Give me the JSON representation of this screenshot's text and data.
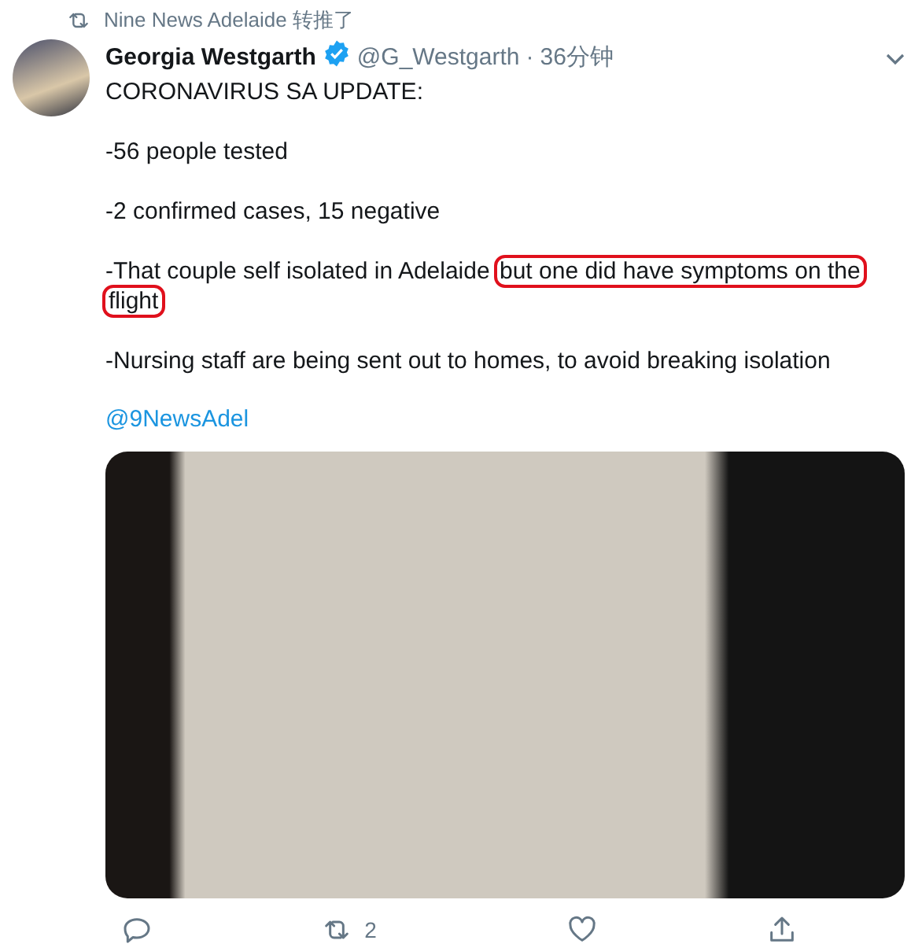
{
  "retweet_banner": {
    "text": "Nine News Adelaide 转推了"
  },
  "tweet": {
    "author_name": "Georgia Westgarth",
    "verified": true,
    "handle": "@G_Westgarth",
    "separator": "·",
    "time": "36分钟",
    "paragraphs": [
      [
        {
          "text": "CORONAVIRUS SA UPDATE:",
          "highlighted": false
        }
      ],
      [
        {
          "text": "-56 people tested",
          "highlighted": false
        }
      ],
      [
        {
          "text": "-2 confirmed cases, 15 negative",
          "highlighted": false
        }
      ],
      [
        {
          "text": "-That couple self isolated in Adelaide",
          "highlighted": false
        },
        {
          "text": "but one did have symptoms on the",
          "highlighted": true
        },
        {
          "text": "flight",
          "highlighted": true
        }
      ],
      [
        {
          "text": "-Nursing staff are being sent out to homes, to avoid breaking isolation",
          "highlighted": false
        }
      ]
    ],
    "mention": "@9NewsAdel",
    "actions": [
      {
        "kind": "reply"
      },
      {
        "kind": "retweet",
        "count": "2"
      },
      {
        "kind": "like"
      },
      {
        "kind": "share"
      }
    ]
  }
}
